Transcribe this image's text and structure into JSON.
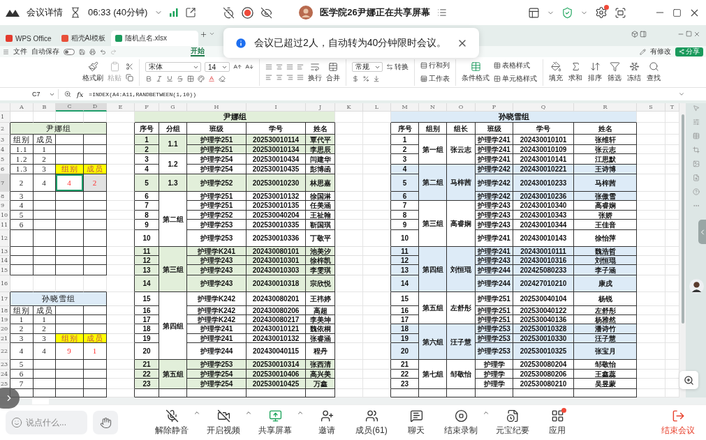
{
  "meeting_bar": {
    "title": "会议详情",
    "timer": "06:33 (40分钟)",
    "sharing_notice": "医学院26尹娜正在共享屏幕",
    "settings_alert": true
  },
  "toast": {
    "message": "会议已超过2人，自动转为40分钟限时会议。"
  },
  "wps_tabs": [
    {
      "label": "WPS Office",
      "selected": false
    },
    {
      "label": "稻壳AI模板",
      "selected": false
    },
    {
      "label": "随机点名.xlsx",
      "selected": true
    }
  ],
  "menu_bar": {
    "file": "文件",
    "autosave": "自动保存",
    "autosave_on": false,
    "ribbon_tab": "开始",
    "changes": "有修改",
    "share": "分享"
  },
  "toolbar": {
    "format_painter": "格式刷",
    "paste": "粘贴",
    "paste_disabled": true,
    "font": "宋体",
    "font_size": "14",
    "wrap": "换行",
    "merge": "合并",
    "number_format": "常规",
    "convert": "转换",
    "rows_cols": "行和列",
    "worksheet": "工作表",
    "conditional_format": "条件格式",
    "table_style": "表格样式",
    "cell_style": "单元格样式",
    "tools": [
      {
        "label": "填充"
      },
      {
        "label": "求和"
      },
      {
        "label": "排序"
      },
      {
        "label": "筛选"
      },
      {
        "label": "冻结"
      },
      {
        "label": "查找"
      }
    ]
  },
  "formula_bar": {
    "name_box": "C7",
    "function_label": "fx",
    "formula": "=INDEX(A4:A11,RANDBETWEEN(1,10))"
  },
  "spreadsheet": {
    "columns": [
      {
        "label": "A",
        "selected": false
      },
      {
        "label": "B",
        "selected": false
      },
      {
        "label": "C",
        "selected": true
      },
      {
        "label": "D",
        "selected": true
      },
      {
        "label": "E",
        "selected": false
      },
      {
        "label": "F",
        "selected": false
      },
      {
        "label": "G",
        "selected": false
      },
      {
        "label": "H",
        "selected": false
      },
      {
        "label": "I",
        "selected": false
      },
      {
        "label": "J",
        "selected": false
      },
      {
        "label": "K",
        "selected": false
      },
      {
        "label": "L",
        "selected": false
      },
      {
        "label": "M",
        "selected": false
      },
      {
        "label": "N",
        "selected": false
      },
      {
        "label": "O",
        "selected": false
      },
      {
        "label": "P",
        "selected": false
      },
      {
        "label": "Q",
        "selected": false
      },
      {
        "label": "R",
        "selected": false
      },
      {
        "label": "S",
        "selected": false
      },
      {
        "label": "T",
        "selected": false
      }
    ],
    "rows": [
      {
        "label": "1",
        "selected": false
      },
      {
        "label": "2",
        "selected": false
      },
      {
        "label": "3",
        "selected": false
      },
      {
        "label": "4",
        "selected": false
      },
      {
        "label": "5",
        "selected": false
      },
      {
        "label": "6",
        "selected": false
      },
      {
        "label": "7",
        "selected": true
      },
      {
        "label": "8",
        "selected": false
      },
      {
        "label": "9",
        "selected": false
      },
      {
        "label": "10",
        "selected": false
      },
      {
        "label": "11",
        "selected": false
      },
      {
        "label": "12",
        "selected": false
      },
      {
        "label": "13",
        "selected": false
      },
      {
        "label": "14",
        "selected": false
      },
      {
        "label": "15",
        "selected": false
      },
      {
        "label": "16",
        "selected": false
      },
      {
        "label": "17",
        "selected": false
      },
      {
        "label": "18",
        "selected": false
      },
      {
        "label": "19",
        "selected": false
      },
      {
        "label": "20",
        "selected": false
      },
      {
        "label": "21",
        "selected": false
      },
      {
        "label": "22",
        "selected": false
      },
      {
        "label": "23",
        "selected": false
      },
      {
        "label": "24",
        "selected": false
      },
      {
        "label": "25",
        "selected": false
      }
    ]
  },
  "summary_tables": [
    {
      "title": "尹娜组",
      "color": "#e2efda",
      "header": [
        "组别",
        "成员"
      ],
      "rows": [
        {
          "kind": "data",
          "selected": false,
          "cells": [
            "1.1",
            "1"
          ]
        },
        {
          "kind": "data",
          "selected": false,
          "cells": [
            "1.2",
            "2"
          ]
        },
        {
          "kind": "pick-label",
          "selected": false,
          "cells": [
            "1.3",
            "3",
            "组别",
            "成员"
          ]
        },
        {
          "kind": "pick-result",
          "selected": true,
          "cells": [
            "2",
            "4",
            "4",
            "2"
          ]
        },
        {
          "kind": "data",
          "selected": false,
          "cells": [
            "3"
          ]
        },
        {
          "kind": "data",
          "selected": false,
          "cells": [
            "4"
          ]
        },
        {
          "kind": "data",
          "selected": false,
          "cells": [
            "5"
          ]
        },
        {
          "kind": "data",
          "selected": false,
          "cells": [
            "6"
          ]
        }
      ]
    },
    {
      "title": "孙晓雪组",
      "color": "#ddebf7",
      "header": [
        "组别",
        "成员"
      ],
      "rows": [
        {
          "kind": "data",
          "selected": false,
          "cells": [
            "1",
            "1"
          ]
        },
        {
          "kind": "data",
          "selected": false,
          "cells": [
            "2",
            "2"
          ]
        },
        {
          "kind": "pick-label",
          "selected": false,
          "cells": [
            "3",
            "3",
            "组别",
            "成员"
          ]
        },
        {
          "kind": "pick-result",
          "selected": false,
          "cells": [
            "4",
            "4",
            "9",
            "1"
          ]
        },
        {
          "kind": "data",
          "selected": false,
          "cells": [
            "5"
          ]
        },
        {
          "kind": "data",
          "selected": false,
          "cells": [
            "6"
          ]
        },
        {
          "kind": "data",
          "selected": false,
          "cells": [
            "7"
          ]
        }
      ]
    }
  ],
  "roster_tables": [
    {
      "title": "尹娜组",
      "color": "#e2efda",
      "columns": [
        "序号",
        "分组",
        "班级",
        "学号",
        "姓名"
      ],
      "groups": [
        {
          "group": "1.1",
          "shaded": true,
          "members": [
            {
              "no": "1",
              "class": "护理学251",
              "id": "202530010114",
              "name": "覃代平"
            },
            {
              "no": "2",
              "class": "护理学251",
              "id": "202530010134",
              "name": "李思辰"
            }
          ]
        },
        {
          "group": "1.2",
          "shaded": false,
          "members": [
            {
              "no": "3",
              "class": "护理学254",
              "id": "202530010434",
              "name": "闫建华"
            },
            {
              "no": "4",
              "class": "护理学254",
              "id": "202530010435",
              "name": "彭博函"
            }
          ]
        },
        {
          "group": "1.3",
          "shaded": true,
          "members": [
            {
              "no": "5",
              "class": "护理学252",
              "id": "202530010230",
              "name": "林思嘉"
            }
          ]
        },
        {
          "group": "第二组",
          "shaded": false,
          "members": [
            {
              "no": "6",
              "class": "护理学251",
              "id": "202530010132",
              "name": "徐国淋"
            },
            {
              "no": "7",
              "class": "护理学251",
              "id": "202530010135",
              "name": "任美涵"
            },
            {
              "no": "8",
              "class": "护理学252",
              "id": "202530040204",
              "name": "王祉翰"
            },
            {
              "no": "9",
              "class": "护理学253",
              "id": "202530010335",
              "name": "靳国琪"
            },
            {
              "no": "10",
              "class": "护理学253",
              "id": "202530010336",
              "name": "丁敬平"
            }
          ]
        },
        {
          "group": "第三组",
          "shaded": true,
          "members": [
            {
              "no": "11",
              "class": "护理学K241",
              "id": "202430080101",
              "name": "池美汐"
            },
            {
              "no": "12",
              "class": "护理学243",
              "id": "202430010301",
              "name": "徐梓凯"
            },
            {
              "no": "13",
              "class": "护理学243",
              "id": "202430010303",
              "name": "李雯琪"
            },
            {
              "no": "14",
              "class": "护理学243",
              "id": "202430010318",
              "name": "宗欣悦"
            }
          ]
        },
        {
          "group": "第四组",
          "shaded": false,
          "members": [
            {
              "no": "15",
              "class": "护理学K242",
              "id": "202430080201",
              "name": "王祎婷"
            },
            {
              "no": "16",
              "class": "护理学K242",
              "id": "202430080206",
              "name": "高超"
            },
            {
              "no": "17",
              "class": "护理学K242",
              "id": "202430080217",
              "name": "李美坤"
            },
            {
              "no": "18",
              "class": "护理学241",
              "id": "202430010121",
              "name": "魏依桐"
            },
            {
              "no": "19",
              "class": "护理学241",
              "id": "202430010132",
              "name": "张睿涵"
            },
            {
              "no": "20",
              "class": "护理学244",
              "id": "202430040115",
              "name": "程丹"
            }
          ]
        },
        {
          "group": "第五组",
          "shaded": true,
          "members": [
            {
              "no": "21",
              "class": "护理学253",
              "id": "202530010314",
              "name": "张西清"
            },
            {
              "no": "22",
              "class": "护理学254",
              "id": "202530010406",
              "name": "高兴美"
            },
            {
              "no": "23",
              "class": "护理学254",
              "id": "202530010425",
              "name": "万鑫"
            }
          ]
        }
      ]
    },
    {
      "title": "孙晓雪组",
      "color": "#ddebf7",
      "columns": [
        "序号",
        "组别",
        "组长",
        "班级",
        "学号",
        "姓名"
      ],
      "groups": [
        {
          "group": "第一组",
          "leader": "张云志",
          "shaded": false,
          "members": [
            {
              "no": "1",
              "class": "护理学241",
              "id": "202430010101",
              "name": "张维轩"
            },
            {
              "no": "2",
              "class": "护理学241",
              "id": "202430010109",
              "name": "张云志"
            },
            {
              "no": "3",
              "class": "护理学241",
              "id": "202430010141",
              "name": "江思默"
            }
          ]
        },
        {
          "group": "第二组",
          "leader": "马梓茜",
          "shaded": true,
          "members": [
            {
              "no": "4",
              "class": "护理学242",
              "id": "202430010221",
              "name": "王诗博"
            },
            {
              "no": "5",
              "class": "护理学242",
              "id": "202430010233",
              "name": "马梓茜"
            },
            {
              "no": "6",
              "class": "护理学242",
              "id": "202430010236",
              "name": "张傲雪"
            }
          ]
        },
        {
          "group": "第三组",
          "leader": "高睿娴",
          "shaded": false,
          "members": [
            {
              "no": "7",
              "class": "护理学243",
              "id": "202430010340",
              "name": "高睿娴"
            },
            {
              "no": "8",
              "class": "护理学243",
              "id": "202430010343",
              "name": "张娇"
            },
            {
              "no": "9",
              "class": "护理学243",
              "id": "202430010344",
              "name": "王佳音"
            },
            {
              "no": "10",
              "class": "护理学241",
              "id": "202430010143",
              "name": "徐怡萍"
            }
          ]
        },
        {
          "group": "第四组",
          "leader": "刘恒琨",
          "shaded": true,
          "members": [
            {
              "no": "11",
              "class": "护理学241",
              "id": "202430010111",
              "name": "魏浩哲"
            },
            {
              "no": "12",
              "class": "护理学243",
              "id": "202430010316",
              "name": "刘恒琨"
            },
            {
              "no": "13",
              "class": "护理学244",
              "id": "202425080233",
              "name": "李子涵"
            },
            {
              "no": "14",
              "class": "护理学244",
              "id": "202427010210",
              "name": "康戌"
            }
          ]
        },
        {
          "group": "第五组",
          "leader": "左舒彤",
          "shaded": false,
          "members": [
            {
              "no": "15",
              "class": "护理学251",
              "id": "202530040104",
              "name": "杨锐"
            },
            {
              "no": "16",
              "class": "护理学251",
              "id": "202530040122",
              "name": "左舒彤"
            },
            {
              "no": "17",
              "class": "护理学251",
              "id": "202530040136",
              "name": "杨雅然"
            }
          ]
        },
        {
          "group": "第六组",
          "leader": "汪子慧",
          "shaded": true,
          "members": [
            {
              "no": "18",
              "class": "护理学253",
              "id": "202530010328",
              "name": "潘诗竹"
            },
            {
              "no": "19",
              "class": "护理学253",
              "id": "202530010330",
              "name": "汪子慧"
            },
            {
              "no": "20",
              "class": "护理学253",
              "id": "202530010325",
              "name": "张宝月"
            }
          ]
        },
        {
          "group": "第七组",
          "leader": "邹敬怡",
          "shaded": false,
          "members": [
            {
              "no": "21",
              "class": "护理学",
              "id": "202530080204",
              "name": "邹敬怡"
            },
            {
              "no": "22",
              "class": "护理学",
              "id": "202530080206",
              "name": "王鑫蕊"
            },
            {
              "no": "23",
              "class": "护理学",
              "id": "202530080210",
              "name": "吴昱蒙"
            }
          ]
        }
      ]
    }
  ],
  "bottom_bar": {
    "chat_placeholder": "说点什么...",
    "controls": [
      {
        "label": "解除静音",
        "menu": true,
        "badge": false
      },
      {
        "label": "开启视频",
        "menu": true,
        "badge": false
      },
      {
        "label": "共享屏幕",
        "menu": true,
        "badge": false
      },
      {
        "label": "邀请",
        "menu": false,
        "badge": false
      },
      {
        "label": "成员(61)",
        "menu": false,
        "badge": false
      },
      {
        "label": "聊天",
        "menu": false,
        "badge": false
      },
      {
        "label": "结束录制",
        "menu": true,
        "badge": false
      },
      {
        "label": "元宝纪要",
        "menu": false,
        "badge": false
      },
      {
        "label": "应用",
        "menu": false,
        "badge": true
      }
    ],
    "end": "结束会议"
  }
}
